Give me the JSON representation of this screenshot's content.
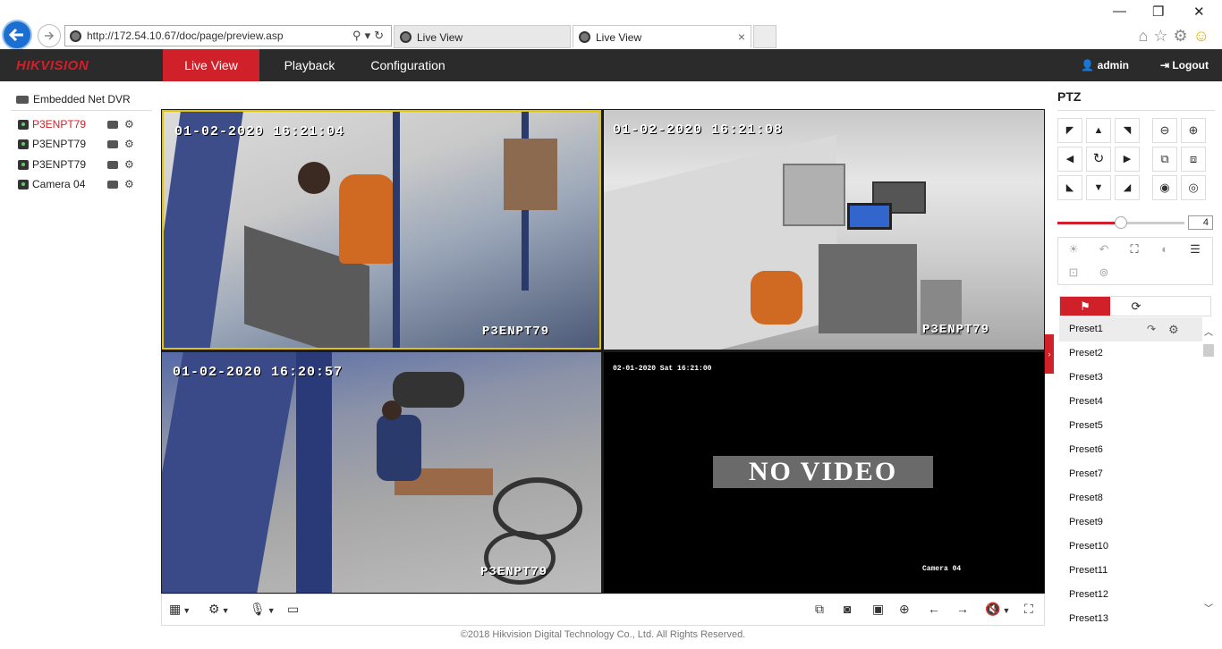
{
  "browser": {
    "url": "http://172.54.10.67/doc/page/preview.asp",
    "tabs": [
      {
        "label": "Live View"
      },
      {
        "label": "Live View"
      }
    ],
    "win_minimize": "—",
    "win_restore": "❐",
    "win_close": "✕",
    "tab_close": "×",
    "url_icons": "⚲▾↻"
  },
  "app": {
    "logo": "HIKVISION",
    "nav": [
      "Live View",
      "Playback",
      "Configuration"
    ],
    "user": "admin",
    "logout": "Logout"
  },
  "tree": {
    "root": "Embedded Net DVR",
    "cameras": [
      {
        "label": "P3ENPT79",
        "active": true
      },
      {
        "label": "P3ENPT79",
        "active": false
      },
      {
        "label": "P3ENPT79",
        "active": false
      },
      {
        "label": "Camera 04",
        "active": false
      }
    ]
  },
  "tiles": [
    {
      "time": "01-02-2020  16:21:04",
      "name": "P3ENPT79"
    },
    {
      "time": "01-02-2020  16:21:08",
      "name": "P3ENPT79"
    },
    {
      "time": "01-02-2020  16:20:57",
      "name": "P3ENPT79"
    },
    {
      "time": "02-01-2020 Sat 16:21:00",
      "name": "Camera 04",
      "no_video": "NO VIDEO"
    }
  ],
  "footer": "©2018 Hikvision Digital Technology Co., Ltd. All Rights Reserved.",
  "ptz": {
    "title": "PTZ",
    "speed": 4,
    "speed_fraction": 0.5,
    "presets": [
      "Preset1",
      "Preset2",
      "Preset3",
      "Preset4",
      "Preset5",
      "Preset6",
      "Preset7",
      "Preset8",
      "Preset9",
      "Preset10",
      "Preset11",
      "Preset12",
      "Preset13"
    ]
  },
  "colors": {
    "accent": "#d0202a",
    "header_bg": "#2b2b2b",
    "selected_tile_border": "#e2c400"
  }
}
